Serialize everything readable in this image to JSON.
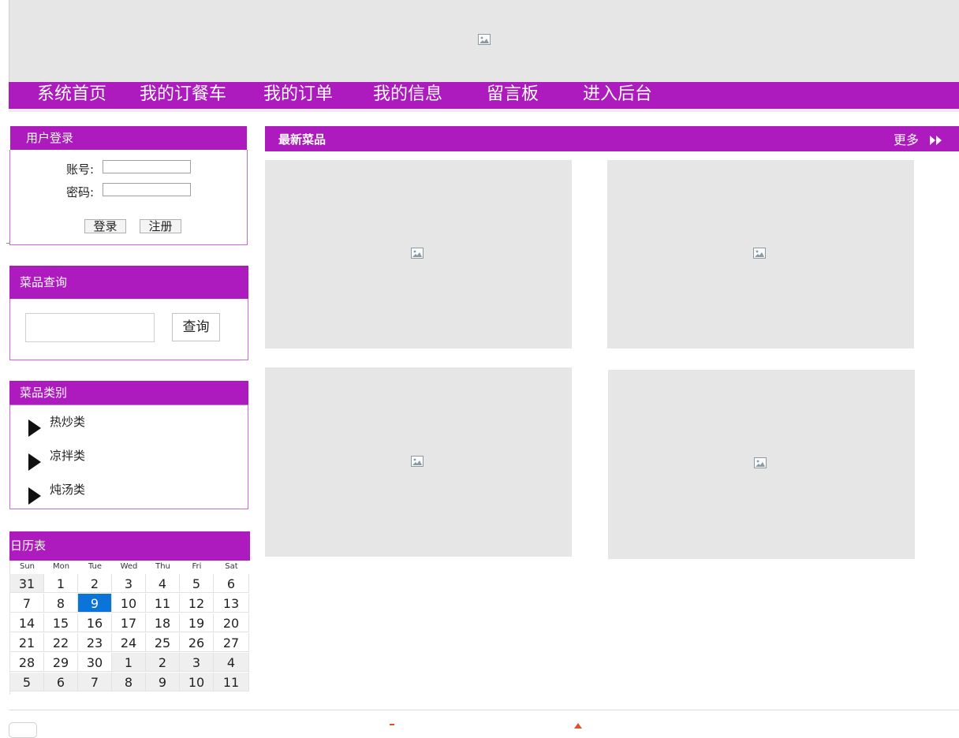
{
  "nav": {
    "items": [
      "系统首页",
      "我的订餐车",
      "我的订单",
      "我的信息",
      "留言板",
      "进入后台"
    ]
  },
  "login": {
    "title": "用户登录",
    "account_label": "账号:",
    "password_label": "密码:",
    "login_button": "登录",
    "register_button": "注册"
  },
  "search": {
    "title": "菜品查询",
    "button": "查询",
    "value": ""
  },
  "categories": {
    "title": "菜品类别",
    "items": [
      "热炒类",
      "凉拌类",
      "炖汤类"
    ]
  },
  "calendar": {
    "title": "日历表",
    "weekdays": [
      "Sun",
      "Mon",
      "Tue",
      "Wed",
      "Thu",
      "Fri",
      "Sat"
    ],
    "weeks": [
      [
        "31",
        "1",
        "2",
        "3",
        "4",
        "5",
        "6"
      ],
      [
        "7",
        "8",
        "9",
        "10",
        "11",
        "12",
        "13"
      ],
      [
        "14",
        "15",
        "16",
        "17",
        "18",
        "19",
        "20"
      ],
      [
        "21",
        "22",
        "23",
        "24",
        "25",
        "26",
        "27"
      ],
      [
        "28",
        "29",
        "30",
        "1",
        "2",
        "3",
        "4"
      ],
      [
        "5",
        "6",
        "7",
        "8",
        "9",
        "10",
        "11"
      ]
    ],
    "today": "9"
  },
  "main": {
    "title": "最新菜品",
    "more_label": "更多",
    "dish_count": 4
  },
  "colors": {
    "accent": "#ad1bbf",
    "placeholder": "#e6e6e6",
    "today_highlight": "#0a74d8"
  },
  "icons": {
    "banner": "image-placeholder-icon",
    "dish": "image-placeholder-icon",
    "more": "double-chevron-right-icon",
    "category_bullet": "triangle-right-icon"
  }
}
